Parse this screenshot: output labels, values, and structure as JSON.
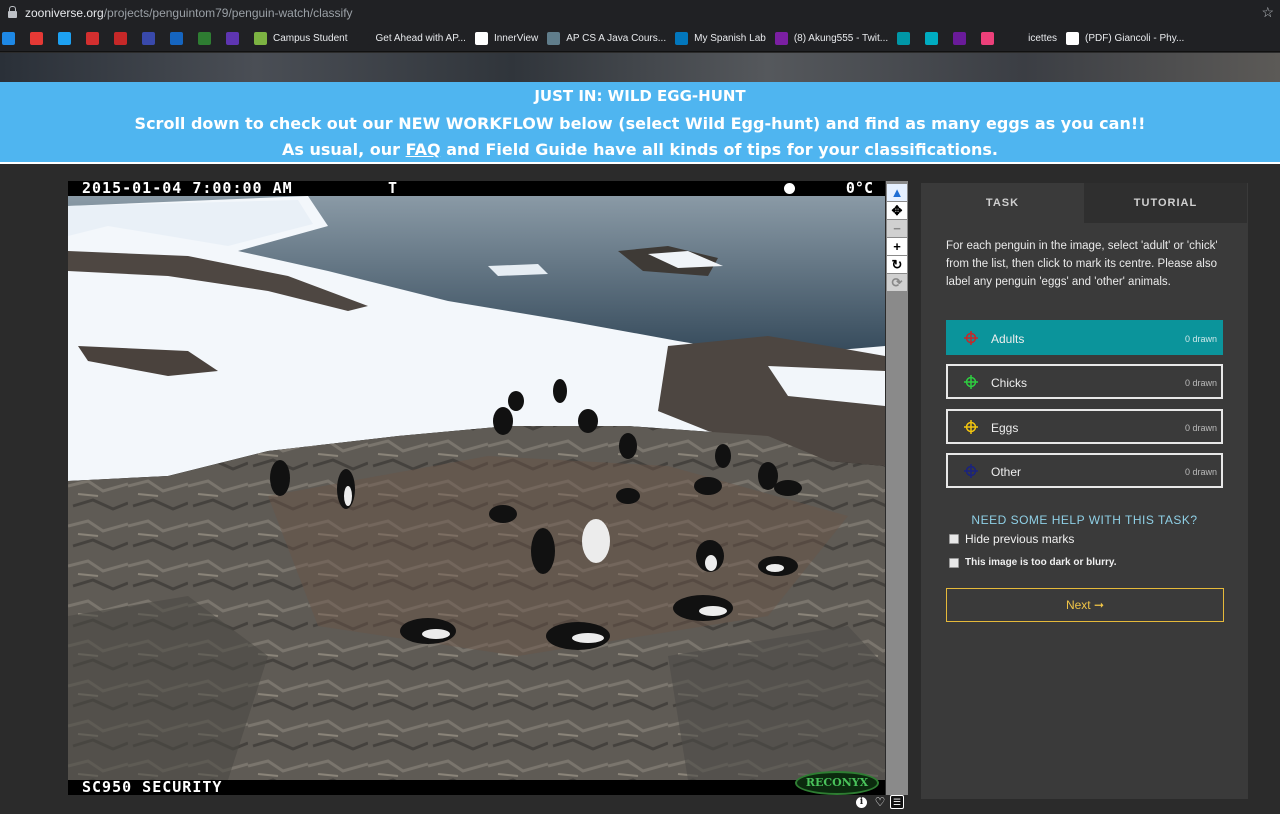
{
  "browser": {
    "url_host": "zooniverse.org",
    "url_path": "/projects/penguintom79/penguin-watch/classify",
    "bookmarks": [
      {
        "label": "",
        "icon": "drive-icon",
        "color": "#1e88e5"
      },
      {
        "label": "",
        "icon": "youtube-icon",
        "color": "#e53935"
      },
      {
        "label": "",
        "icon": "twitter-icon",
        "color": "#1da1f2"
      },
      {
        "label": "",
        "icon": "pinterest-icon",
        "color": "#d32f2f"
      },
      {
        "label": "",
        "icon": "app-icon",
        "color": "#c62828"
      },
      {
        "label": "",
        "icon": "mail-icon",
        "color": "#3949ab"
      },
      {
        "label": "",
        "icon": "a-icon",
        "color": "#1565c0"
      },
      {
        "label": "",
        "icon": "green-circle-icon",
        "color": "#2e7d32"
      },
      {
        "label": "",
        "icon": "m-icon",
        "color": "#5e35b1"
      },
      {
        "label": "Campus Student",
        "icon": "campus-icon",
        "color": "#7cb342"
      },
      {
        "label": "Get Ahead with AP...",
        "icon": "",
        "color": "#202124"
      },
      {
        "label": "InnerView",
        "icon": "innerview-icon",
        "color": "#ffffff"
      },
      {
        "label": "AP CS A Java Cours...",
        "icon": "course-icon",
        "color": "#607d8b"
      },
      {
        "label": "My Spanish Lab",
        "icon": "spanish-icon",
        "color": "#0277bd"
      },
      {
        "label": "(8) Akung555 - Twit...",
        "icon": "twitch-icon",
        "color": "#7b1fa2"
      },
      {
        "label": "",
        "icon": "blue-app-icon",
        "color": "#0097a7"
      },
      {
        "label": "",
        "icon": "teal-app-icon",
        "color": "#00acc1"
      },
      {
        "label": "",
        "icon": "k-icon",
        "color": "#6a1b9a"
      },
      {
        "label": "",
        "icon": "flag-icon",
        "color": "#ec407a"
      },
      {
        "label": "icettes",
        "icon": "",
        "color": "#202124"
      },
      {
        "label": "(PDF) Giancoli - Phy...",
        "icon": "academia-icon",
        "color": "#ffffff"
      }
    ]
  },
  "announcement": {
    "line1": "JUST IN: WILD EGG-HUNT",
    "line2": "Scroll down to check out our NEW WORKFLOW below (select Wild Egg-hunt) and find as many eggs as you can!!",
    "line3_pre": "As usual, our ",
    "line3_link": "FAQ",
    "line3_post": " and Field Guide have all kinds of tips for your classifications."
  },
  "subject": {
    "date_time": "2015-01-04  7:00:00 AM",
    "t_marker": "T",
    "temperature": "0°C",
    "camera_label": "SC950  SECURITY",
    "logo_text": "RECONYX"
  },
  "toolbar": {
    "tools": [
      {
        "name": "pointer-tool",
        "glyph": "▲"
      },
      {
        "name": "pan-tool",
        "glyph": "✥"
      },
      {
        "name": "zoom-out-tool",
        "glyph": "−"
      },
      {
        "name": "zoom-in-tool",
        "glyph": "+"
      },
      {
        "name": "rotate-tool",
        "glyph": "↻"
      },
      {
        "name": "reset-tool",
        "glyph": "⟳"
      }
    ]
  },
  "task_panel": {
    "tab_task": "TASK",
    "tab_tutorial": "TUTORIAL",
    "instructions": "For each penguin in the image, select 'adult' or 'chick' from the list, then click to mark its centre. Please also label any penguin 'eggs' and 'other' animals.",
    "choices": [
      {
        "label": "Adults",
        "count": "0 drawn",
        "color": "#c62828",
        "selected": true
      },
      {
        "label": "Chicks",
        "count": "0 drawn",
        "color": "#2ecc40",
        "selected": false
      },
      {
        "label": "Eggs",
        "count": "0 drawn",
        "color": "#f1c40f",
        "selected": false
      },
      {
        "label": "Other",
        "count": "0 drawn",
        "color": "#1a237e",
        "selected": false
      }
    ],
    "help_text": "NEED SOME HELP WITH THIS TASK?",
    "hide_marks_label": "Hide previous marks",
    "too_dark_label": "This image is too dark or blurry.",
    "next_label": "Next ➞"
  },
  "colors": {
    "announcement_bg": "#4fb5f0",
    "selected_choice": "#0b949b",
    "next_border": "#e5b93a",
    "page_bg": "#2b2b2b",
    "panel_bg": "#3a3a3a"
  }
}
